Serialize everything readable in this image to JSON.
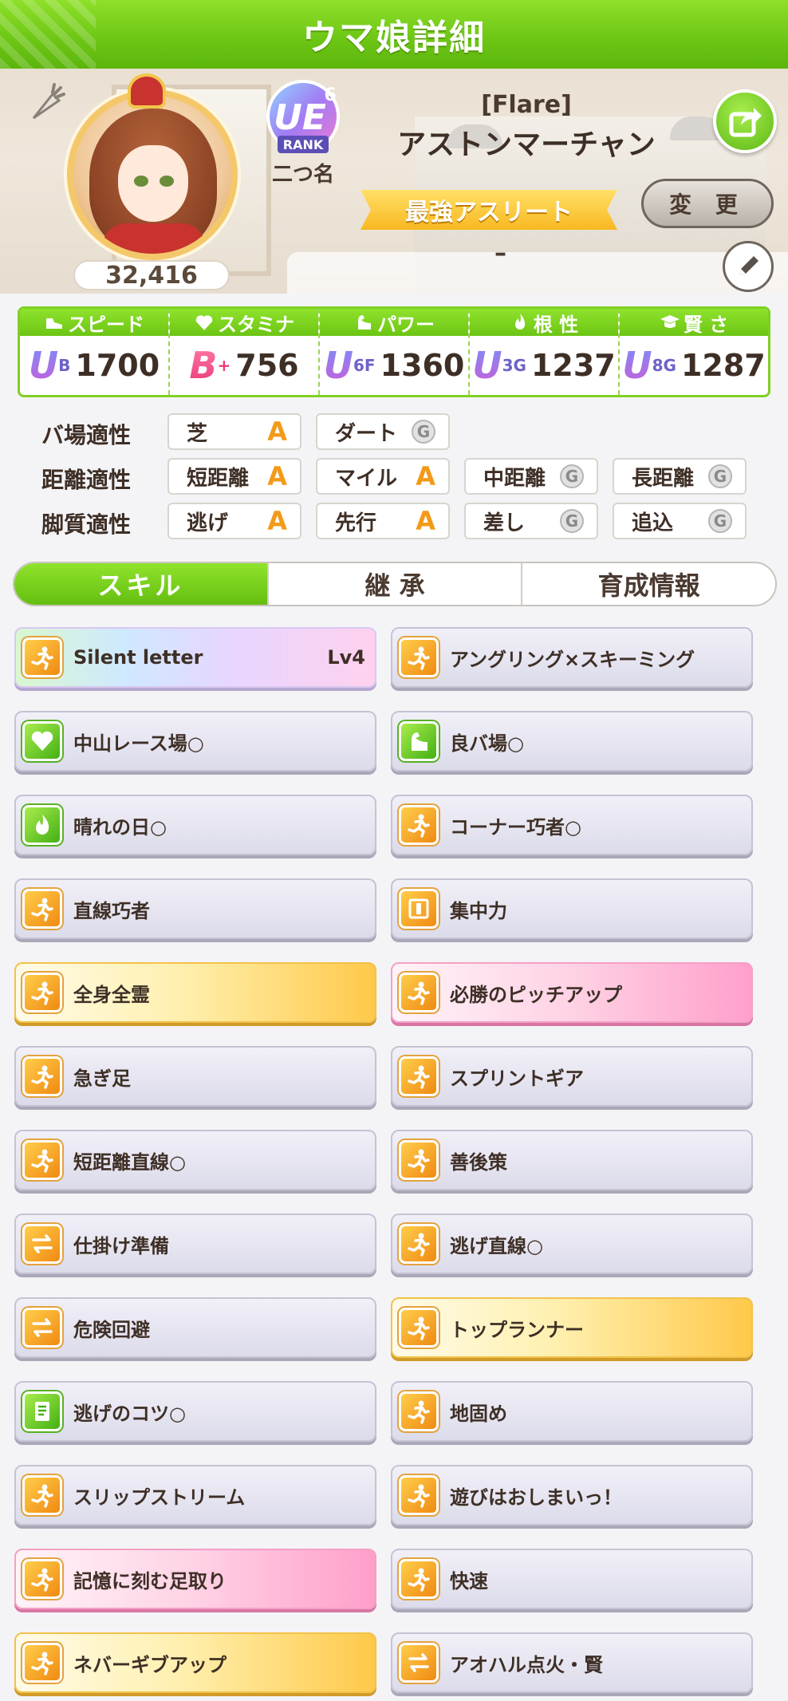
{
  "header": {
    "title": "ウマ娘詳細"
  },
  "profile": {
    "score": "32,416",
    "rank": {
      "label": "RANK",
      "grade": "UE",
      "sub": "6",
      "title_label": "二つ名"
    },
    "epithet": "[Flare]",
    "name": "アストンマーチャン",
    "title_ribbon": "最強アスリート",
    "change_label": "変 更",
    "memo": "–"
  },
  "stats": [
    {
      "name": "スピード",
      "icon": "shoe-icon",
      "grade": "U",
      "sub": "B",
      "value": "1700"
    },
    {
      "name": "スタミナ",
      "icon": "heart-icon",
      "grade": "B",
      "sub": "+",
      "value": "756"
    },
    {
      "name": "パワー",
      "icon": "muscle-icon",
      "grade": "U",
      "sub": "6F",
      "value": "1360"
    },
    {
      "name": "根 性",
      "icon": "flame-icon",
      "grade": "U",
      "sub": "3G",
      "value": "1237"
    },
    {
      "name": "賢 さ",
      "icon": "graduation-cap-icon",
      "grade": "U",
      "sub": "8G",
      "value": "1287"
    }
  ],
  "aptitude": {
    "track": {
      "label": "バ場適性",
      "items": [
        {
          "name": "芝",
          "grade": "A"
        },
        {
          "name": "ダート",
          "grade": "G"
        }
      ]
    },
    "distance": {
      "label": "距離適性",
      "items": [
        {
          "name": "短距離",
          "grade": "A"
        },
        {
          "name": "マイル",
          "grade": "A"
        },
        {
          "name": "中距離",
          "grade": "G"
        },
        {
          "name": "長距離",
          "grade": "G"
        }
      ]
    },
    "style": {
      "label": "脚質適性",
      "items": [
        {
          "name": "逃げ",
          "grade": "A"
        },
        {
          "name": "先行",
          "grade": "A"
        },
        {
          "name": "差し",
          "grade": "G"
        },
        {
          "name": "追込",
          "grade": "G"
        }
      ]
    }
  },
  "tabs": [
    "スキル",
    "継 承",
    "育成情報"
  ],
  "skills": [
    {
      "name": "Silent letter",
      "level": "Lv4",
      "style": "rainbow",
      "icon": "runner-icon"
    },
    {
      "name": "アングリング×スキーミング",
      "style": "normal",
      "icon": "runner-icon"
    },
    {
      "name": "中山レース場○",
      "style": "normal",
      "icon": "heart-icon"
    },
    {
      "name": "良バ場○",
      "style": "normal",
      "icon": "muscle-icon"
    },
    {
      "name": "晴れの日○",
      "style": "normal",
      "icon": "flame-icon"
    },
    {
      "name": "コーナー巧者○",
      "style": "normal",
      "icon": "runner-icon"
    },
    {
      "name": "直線巧者",
      "style": "normal",
      "icon": "runner-icon"
    },
    {
      "name": "集中力",
      "style": "normal",
      "icon": "gate-icon"
    },
    {
      "name": "全身全霊",
      "style": "gold",
      "icon": "runner-icon"
    },
    {
      "name": "必勝のピッチアップ",
      "style": "pink",
      "icon": "runner-icon"
    },
    {
      "name": "急ぎ足",
      "style": "normal",
      "icon": "runner-icon"
    },
    {
      "name": "スプリントギア",
      "style": "normal",
      "icon": "runner-icon"
    },
    {
      "name": "短距離直線○",
      "style": "normal",
      "icon": "runner-icon"
    },
    {
      "name": "善後策",
      "style": "normal",
      "icon": "runner-icon"
    },
    {
      "name": "仕掛け準備",
      "style": "normal",
      "icon": "swap-icon"
    },
    {
      "name": "逃げ直線○",
      "style": "normal",
      "icon": "runner-icon"
    },
    {
      "name": "危険回避",
      "style": "normal",
      "icon": "swap-icon"
    },
    {
      "name": "トップランナー",
      "style": "gold",
      "icon": "runner-icon"
    },
    {
      "name": "逃げのコツ○",
      "style": "normal",
      "icon": "book-icon"
    },
    {
      "name": "地固め",
      "style": "normal",
      "icon": "runner-icon"
    },
    {
      "name": "スリップストリーム",
      "style": "normal",
      "icon": "runner-icon"
    },
    {
      "name": "遊びはおしまいっ！",
      "style": "normal",
      "icon": "runner-icon"
    },
    {
      "name": "記憶に刻む足取り",
      "style": "pink",
      "icon": "runner-icon"
    },
    {
      "name": "快速",
      "style": "normal",
      "icon": "runner-icon"
    },
    {
      "name": "ネバーギブアップ",
      "style": "gold",
      "icon": "runner-icon"
    },
    {
      "name": "アオハル点火・賢",
      "style": "normal",
      "icon": "swap-icon"
    }
  ]
}
